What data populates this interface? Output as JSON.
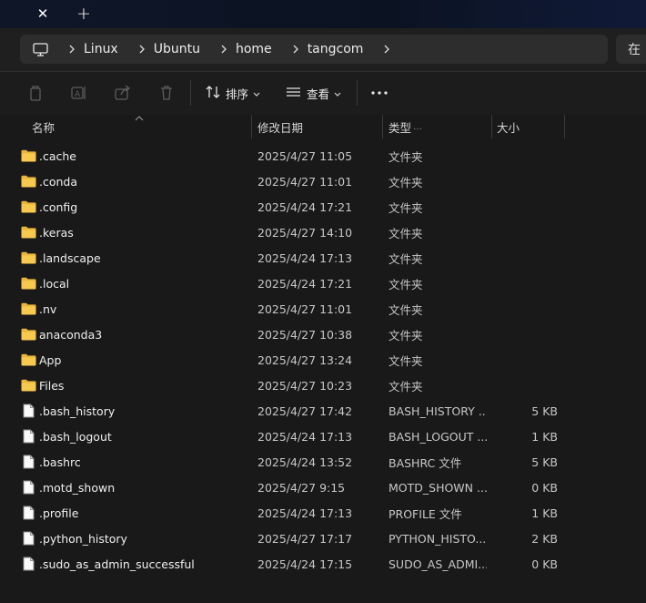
{
  "window": {
    "tab_close_glyph": "✕",
    "new_tab_glyph": "+"
  },
  "address": {
    "breadcrumbs": [
      "Linux",
      "Ubuntu",
      "home",
      "tangcom"
    ],
    "search_hint": "在"
  },
  "toolbar": {
    "sort_label": "排序",
    "view_label": "查看"
  },
  "columns": {
    "name": "名称",
    "date": "修改日期",
    "type": "类型",
    "size": "大小"
  },
  "files": [
    {
      "name": ".cache",
      "date": "2025/4/27 11:05",
      "type": "文件夹",
      "size": "",
      "icon": "folder-icon"
    },
    {
      "name": ".conda",
      "date": "2025/4/27 11:01",
      "type": "文件夹",
      "size": "",
      "icon": "folder-icon"
    },
    {
      "name": ".config",
      "date": "2025/4/24 17:21",
      "type": "文件夹",
      "size": "",
      "icon": "folder-icon"
    },
    {
      "name": ".keras",
      "date": "2025/4/27 14:10",
      "type": "文件夹",
      "size": "",
      "icon": "folder-icon"
    },
    {
      "name": ".landscape",
      "date": "2025/4/24 17:13",
      "type": "文件夹",
      "size": "",
      "icon": "folder-icon"
    },
    {
      "name": ".local",
      "date": "2025/4/24 17:21",
      "type": "文件夹",
      "size": "",
      "icon": "folder-icon"
    },
    {
      "name": ".nv",
      "date": "2025/4/27 11:01",
      "type": "文件夹",
      "size": "",
      "icon": "folder-icon"
    },
    {
      "name": "anaconda3",
      "date": "2025/4/27 10:38",
      "type": "文件夹",
      "size": "",
      "icon": "folder-icon"
    },
    {
      "name": "App",
      "date": "2025/4/27 13:24",
      "type": "文件夹",
      "size": "",
      "icon": "folder-icon"
    },
    {
      "name": "Files",
      "date": "2025/4/27 10:23",
      "type": "文件夹",
      "size": "",
      "icon": "folder-icon"
    },
    {
      "name": ".bash_history",
      "date": "2025/4/27 17:42",
      "type": "BASH_HISTORY ...",
      "size": "5 KB",
      "icon": "file-icon"
    },
    {
      "name": ".bash_logout",
      "date": "2025/4/24 17:13",
      "type": "BASH_LOGOUT ...",
      "size": "1 KB",
      "icon": "file-icon"
    },
    {
      "name": ".bashrc",
      "date": "2025/4/24 13:52",
      "type": "BASHRC 文件",
      "size": "5 KB",
      "icon": "file-icon"
    },
    {
      "name": ".motd_shown",
      "date": "2025/4/27 9:15",
      "type": "MOTD_SHOWN ...",
      "size": "0 KB",
      "icon": "file-icon"
    },
    {
      "name": ".profile",
      "date": "2025/4/24 17:13",
      "type": "PROFILE 文件",
      "size": "1 KB",
      "icon": "file-icon"
    },
    {
      "name": ".python_history",
      "date": "2025/4/27 17:17",
      "type": "PYTHON_HISTO...",
      "size": "2 KB",
      "icon": "file-icon"
    },
    {
      "name": ".sudo_as_admin_successful",
      "date": "2025/4/24 17:15",
      "type": "SUDO_AS_ADMI...",
      "size": "0 KB",
      "icon": "file-icon"
    }
  ]
}
